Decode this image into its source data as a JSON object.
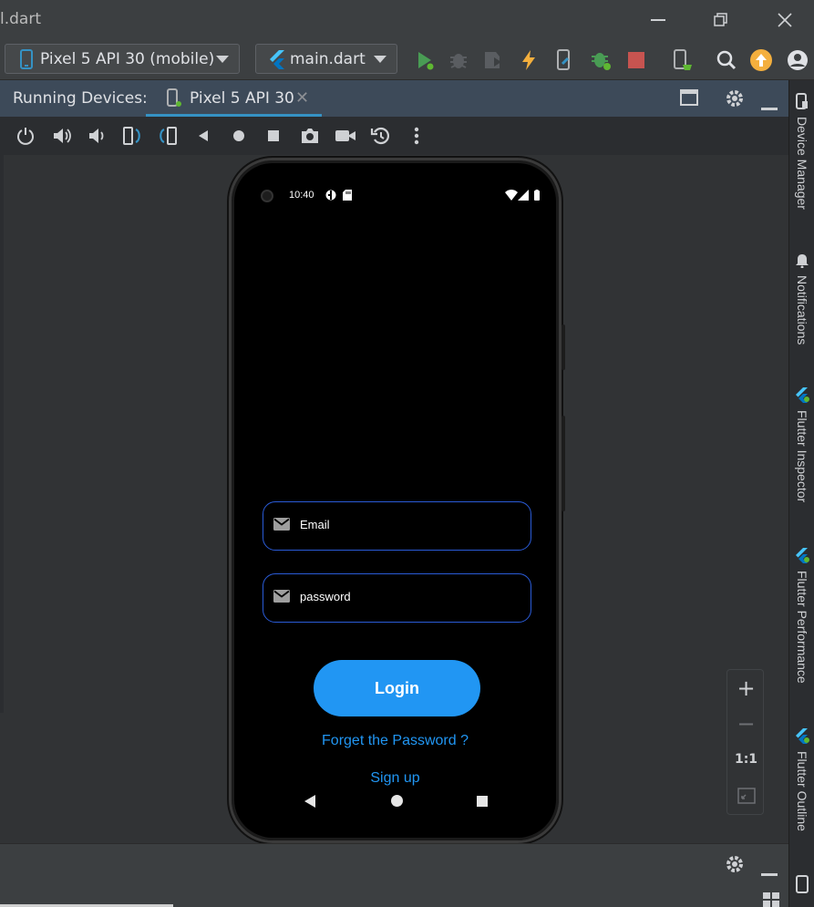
{
  "window": {
    "title": "l.dart"
  },
  "toolbar": {
    "device_selector": "Pixel 5 API 30 (mobile)",
    "file_selector": "main.dart",
    "icons": [
      "run-icon",
      "debug-icon",
      "profile-icon",
      "hot-reload-icon",
      "attach-icon",
      "flutter-attach-icon",
      "stop-icon",
      "device-mirroring-icon",
      "search-icon",
      "update-icon",
      "account-icon"
    ]
  },
  "running_devices": {
    "label": "Running Devices:",
    "tab_label": "Pixel 5 API 30"
  },
  "emulator_controls": [
    "power-icon",
    "volume-up-icon",
    "volume-down-icon",
    "rotate-left-icon",
    "rotate-right-icon",
    "back-icon",
    "home-icon",
    "overview-icon",
    "screenshot-icon",
    "screen-record-icon",
    "snapshot-icon",
    "more-icon"
  ],
  "phone": {
    "status_time": "10:40",
    "email_placeholder": "Email",
    "password_placeholder": "password",
    "login_label": "Login",
    "forget_password": "Forget the Password ?",
    "sign_up": "Sign up"
  },
  "zoom": {
    "plus": "+",
    "minus": "−",
    "one_to_one": "1:1"
  },
  "side_tools": [
    "Device Manager",
    "Notifications",
    "Flutter Inspector",
    "Flutter Performance",
    "Flutter Outline"
  ],
  "colors": {
    "accent": "#2196f3",
    "field_border": "#2a5bd7",
    "ide_bg": "#2b2d30",
    "tab_header": "#3d4a59"
  }
}
